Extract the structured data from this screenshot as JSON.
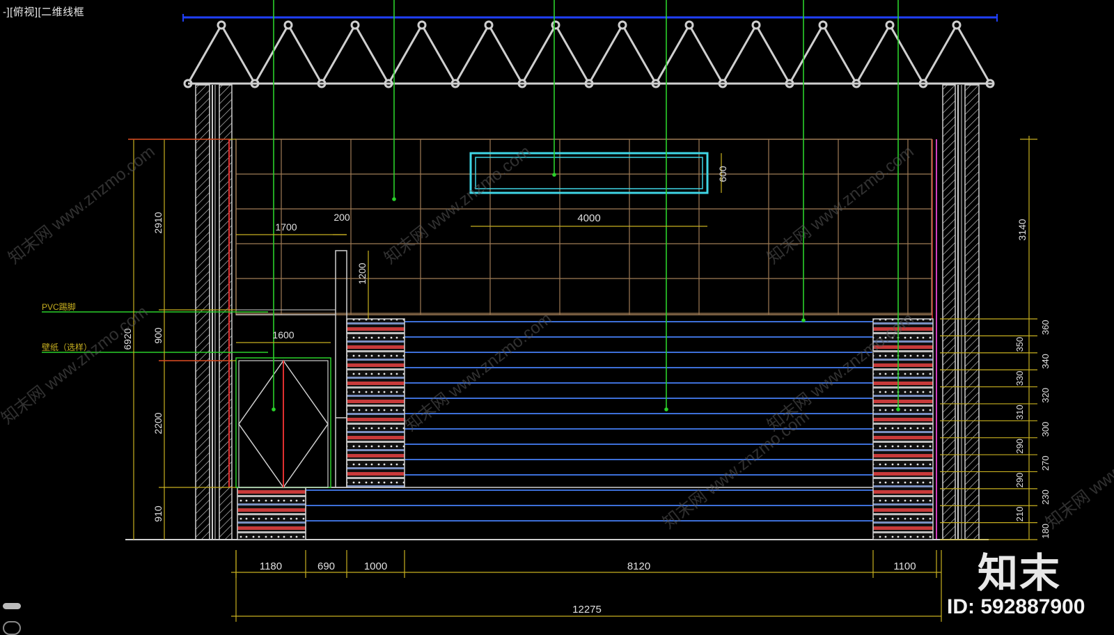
{
  "viewport": {
    "label": "-][俯视][二维线框"
  },
  "left_annotations": {
    "pvc": "PVC踢脚",
    "wallpaper": "壁纸（选样）"
  },
  "left_dims": {
    "total": "6920",
    "a": "2910",
    "b": "900",
    "c": "2200",
    "d": "910"
  },
  "top_dims": {
    "d1700": "1700",
    "d200": "200",
    "d4000": "4000",
    "d600": "600",
    "d1200": "1200",
    "d1600": "1600"
  },
  "right_dims": {
    "top": "3140",
    "list": [
      "360",
      "350",
      "340",
      "330",
      "320",
      "310",
      "300",
      "290",
      "270",
      "290",
      "230",
      "210",
      "180"
    ]
  },
  "bottom_dims": {
    "list": [
      "1180",
      "690",
      "1000",
      "8120",
      "1100"
    ],
    "total": "12275"
  },
  "watermark": "知末网 www.znzmo.com",
  "logo": "知末",
  "asset_id": "ID: 592887900",
  "colors": {
    "background": "#000000",
    "structure": "#d0d0d0",
    "dimension": "#c8b020",
    "grid": "#a07c56",
    "leader": "#2ad12a",
    "stripe": "#3d6fd8",
    "cyan": "#3fd6e6",
    "red": "#e03030",
    "magenta": "#d040c0",
    "topline": "#2040ff"
  }
}
